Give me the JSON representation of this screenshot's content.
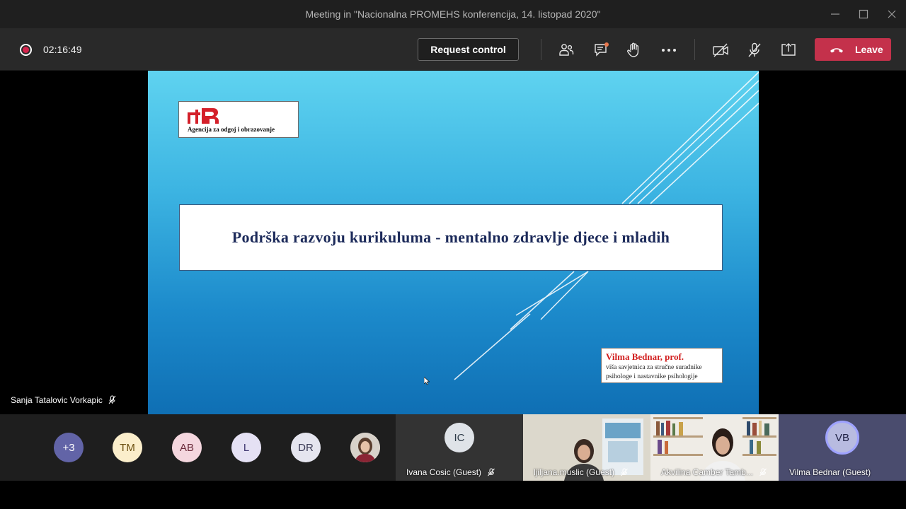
{
  "window": {
    "title": "Meeting in \"Nacionalna PROMEHS konferencija, 14. listopad 2020\""
  },
  "toolbar": {
    "timer": "02:16:49",
    "request_control_label": "Request control",
    "leave_label": "Leave",
    "icons": [
      "participants-icon",
      "chat-icon",
      "raise-hand-icon",
      "more-options-icon",
      "camera-off-icon",
      "mic-off-icon",
      "share-tray-icon"
    ]
  },
  "slide": {
    "logo_text": "Agencija za odgoj i obrazovanje",
    "title": "Podrška razvoju kurikuluma - mentalno zdravlje djece i mladih",
    "author_name": "Vilma Bednar, prof.",
    "author_role_line1": "viša savjetnica za stručne suradnike",
    "author_role_line2": "psihologe i nastavnike psihologije"
  },
  "stage": {
    "active_speaker": "Sanja Tatalovic Vorkapic"
  },
  "participants": {
    "avatars": [
      {
        "initials": "+3",
        "color": "#6264a7",
        "text_color": "#ffffff"
      },
      {
        "initials": "TM",
        "color": "#fbeecb",
        "text_color": "#6b4f10"
      },
      {
        "initials": "AB",
        "color": "#f4d6de",
        "text_color": "#6b2a3a"
      },
      {
        "initials": "L",
        "color": "#e5e1f4",
        "text_color": "#3e3670"
      },
      {
        "initials": "DR",
        "color": "#e5e5ef",
        "text_color": "#3a3a55"
      }
    ],
    "tiles": [
      {
        "initials": "IC",
        "name": "Ivana Cosic (Guest)"
      },
      {
        "name": "ljiljana.muslic (Guest)"
      },
      {
        "name": "Akvilina Camber Tamb..."
      },
      {
        "initials": "VB",
        "name": "Vilma Bednar (Guest)"
      }
    ]
  },
  "colors": {
    "leave": "#c4314b",
    "accent": "#6264a7"
  }
}
